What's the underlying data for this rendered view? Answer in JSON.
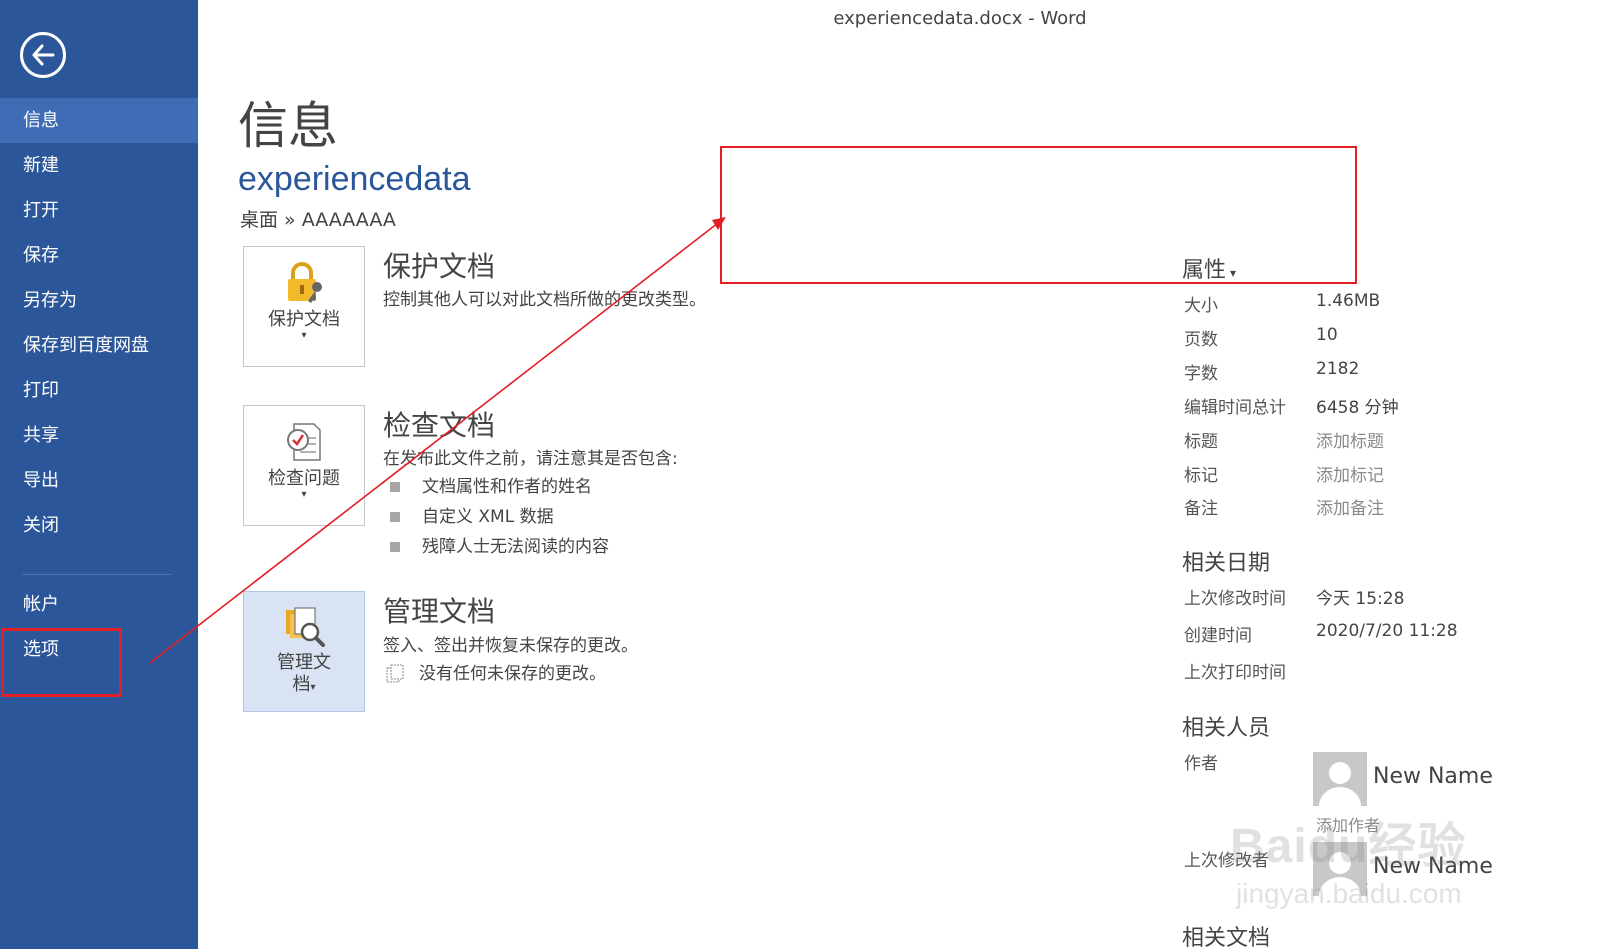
{
  "window": {
    "title": "experiencedata.docx - Word"
  },
  "sidebar": {
    "items": [
      {
        "label": "信息"
      },
      {
        "label": "新建"
      },
      {
        "label": "打开"
      },
      {
        "label": "保存"
      },
      {
        "label": "另存为"
      },
      {
        "label": "保存到百度网盘"
      },
      {
        "label": "打印"
      },
      {
        "label": "共享"
      },
      {
        "label": "导出"
      },
      {
        "label": "关闭"
      },
      {
        "label": "帐户"
      },
      {
        "label": "选项"
      }
    ],
    "active_index": 0
  },
  "main": {
    "page_title": "信息",
    "doc_name": "experiencedata",
    "breadcrumb": "桌面 » AAAAAAA",
    "protect": {
      "tile_label": "保护文档",
      "title": "保护文档",
      "desc": "控制其他人可以对此文档所做的更改类型。"
    },
    "inspect": {
      "tile_label": "检查问题",
      "title": "检查文档",
      "desc": "在发布此文件之前，请注意其是否包含:",
      "bullets": [
        "文档属性和作者的姓名",
        "自定义 XML 数据",
        "残障人士无法阅读的内容"
      ]
    },
    "manage": {
      "tile_label_line1": "管理文",
      "tile_label_line2": "档",
      "title": "管理文档",
      "desc": "签入、签出并恢复未保存的更改。",
      "note": "没有任何未保存的更改。"
    }
  },
  "properties": {
    "heading": "属性",
    "heading_caret": "▾",
    "rows": [
      {
        "key": "大小",
        "value": "1.46MB"
      },
      {
        "key": "页数",
        "value": "10"
      },
      {
        "key": "字数",
        "value": "2182"
      },
      {
        "key": "编辑时间总计",
        "value": "6458 分钟"
      },
      {
        "key": "标题",
        "value": "添加标题"
      },
      {
        "key": "标记",
        "value": "添加标记"
      },
      {
        "key": "备注",
        "value": "添加备注"
      }
    ],
    "dates_heading": "相关日期",
    "dates": [
      {
        "key": "上次修改时间",
        "value": "今天 15:28"
      },
      {
        "key": "创建时间",
        "value": "2020/7/20 11:28"
      },
      {
        "key": "上次打印时间",
        "value": ""
      }
    ],
    "people_heading": "相关人员",
    "author_key": "作者",
    "author_name": "New Name",
    "add_author": "添加作者",
    "last_modified_key": "上次修改者",
    "last_modified_name": "New Name",
    "docs_heading": "相关文档"
  },
  "watermark": {
    "text": "Baidu经验",
    "sub": "jingyan.baidu.com"
  },
  "colors": {
    "sidebar": "#2b579a",
    "active": "#3e6db5",
    "accent": "#2b579a",
    "annotation": "#e31e24"
  }
}
